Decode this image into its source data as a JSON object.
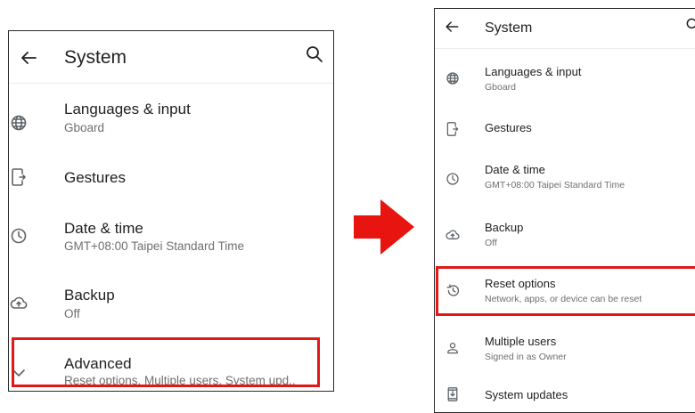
{
  "left": {
    "title": "System",
    "items": [
      {
        "title": "Languages & input",
        "subtitle": "Gboard",
        "icon": "globe-icon"
      },
      {
        "title": "Gestures",
        "subtitle": "",
        "icon": "gestures-icon"
      },
      {
        "title": "Date & time",
        "subtitle": "GMT+08:00 Taipei Standard Time",
        "icon": "clock-icon"
      },
      {
        "title": "Backup",
        "subtitle": "Off",
        "icon": "cloud-upload-icon"
      },
      {
        "title": "Advanced",
        "subtitle": "Reset options, Multiple users, System upd..",
        "icon": "chevron-down-icon"
      }
    ]
  },
  "right": {
    "title": "System",
    "items": [
      {
        "title": "Languages & input",
        "subtitle": "Gboard",
        "icon": "globe-icon"
      },
      {
        "title": "Gestures",
        "subtitle": "",
        "icon": "gestures-icon"
      },
      {
        "title": "Date & time",
        "subtitle": "GMT+08:00 Taipei Standard Time",
        "icon": "clock-icon"
      },
      {
        "title": "Backup",
        "subtitle": "Off",
        "icon": "cloud-upload-icon"
      },
      {
        "title": "Reset options",
        "subtitle": "Network, apps, or device can be reset",
        "icon": "history-icon"
      },
      {
        "title": "Multiple users",
        "subtitle": "Signed in as Owner",
        "icon": "person-icon"
      },
      {
        "title": "System updates",
        "subtitle": "",
        "icon": "system-update-icon"
      }
    ]
  },
  "colors": {
    "highlight": "#e01818",
    "arrow": "#e8140f"
  }
}
